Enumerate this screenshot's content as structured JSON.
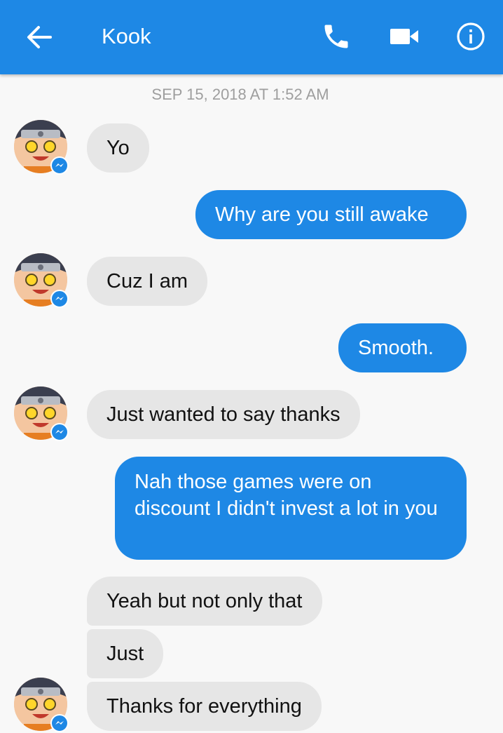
{
  "header": {
    "contact_name": "Kook",
    "back_icon": "arrow-left-icon",
    "call_icon": "phone-icon",
    "video_icon": "video-camera-icon",
    "info_icon": "info-icon",
    "background_color": "#1e88e5"
  },
  "conversation": {
    "timestamp": "SEP 15, 2018 AT 1:52 AM",
    "messages": [
      {
        "sender": "them",
        "text": "Yo"
      },
      {
        "sender": "me",
        "text": "Why are you still awake"
      },
      {
        "sender": "them",
        "text": "Cuz I am"
      },
      {
        "sender": "me",
        "text": "Smooth."
      },
      {
        "sender": "them",
        "text": "Just wanted to say thanks"
      },
      {
        "sender": "me",
        "text": "Nah those games were on discount I didn't invest a lot in you"
      },
      {
        "sender": "them",
        "text": "Yeah but not only that"
      },
      {
        "sender": "them",
        "text": "Just"
      },
      {
        "sender": "them",
        "text": "Thanks for everything"
      }
    ]
  },
  "colors": {
    "outgoing_bubble": "#1e88e5",
    "incoming_bubble": "#e6e6e6",
    "messenger_badge": "#1e88e5"
  }
}
